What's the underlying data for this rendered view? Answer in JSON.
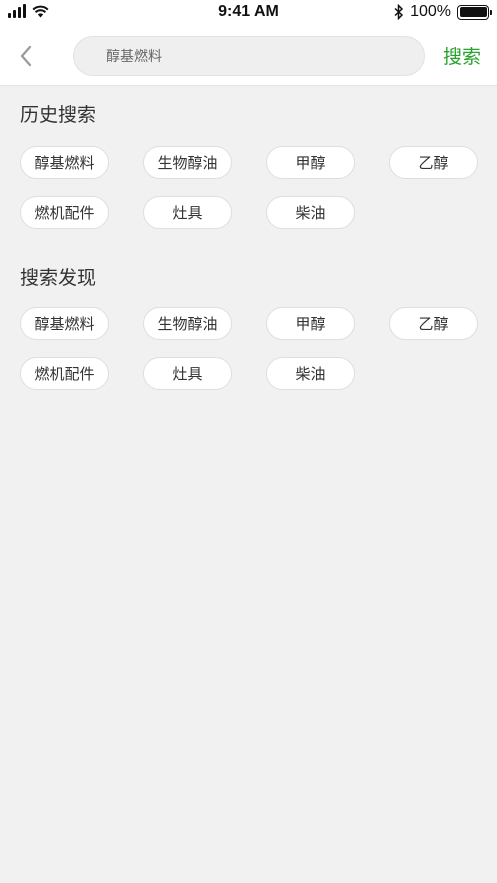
{
  "status_bar": {
    "time": "9:41 AM",
    "battery": "100%",
    "icons": [
      "signal-icon",
      "wifi-icon",
      "bluetooth-icon",
      "battery-icon"
    ]
  },
  "nav": {
    "back_icon": "chevron-left-icon",
    "search_value": "醇基燃料",
    "search_button": "搜索",
    "accent_color": "#27a22a"
  },
  "history": {
    "title": "历史搜索",
    "tags": [
      "醇基燃料",
      "生物醇油",
      "甲醇",
      "乙醇",
      "燃机配件",
      "灶具",
      "柴油"
    ]
  },
  "discover": {
    "title": "搜索发现",
    "tags": [
      "醇基燃料",
      "生物醇油",
      "甲醇",
      "乙醇",
      "燃机配件",
      "灶具",
      "柴油"
    ]
  }
}
